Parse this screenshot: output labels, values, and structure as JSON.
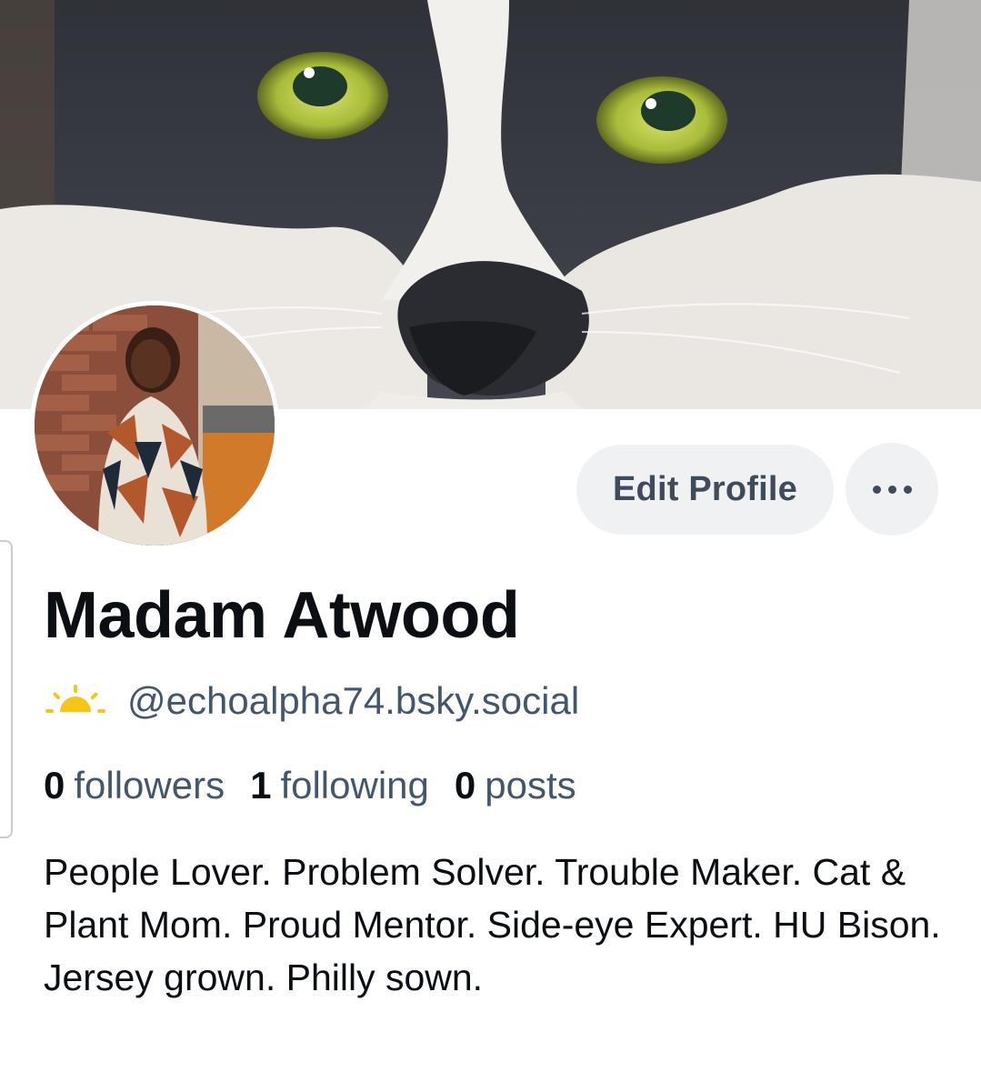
{
  "profile": {
    "display_name": "Madam Atwood",
    "handle": "@echoalpha74.bsky.social",
    "bio": "People Lover. Problem Solver. Trouble Maker. Cat & Plant Mom. Proud Mentor. Side-eye Expert. HU Bison. Jersey grown. Philly sown.",
    "handle_icon": "sunrise-icon",
    "banner": "cat-face-banner",
    "avatar": "avatar-photo"
  },
  "actions": {
    "edit_label": "Edit Profile",
    "more_icon": "ellipsis-icon"
  },
  "stats": {
    "followers_count": "0",
    "followers_label": "followers",
    "following_count": "1",
    "following_label": "following",
    "posts_count": "0",
    "posts_label": "posts"
  },
  "colors": {
    "secondary_text": "#42576c",
    "button_bg": "#eff1f3",
    "sun_icon": "#f5c518"
  }
}
